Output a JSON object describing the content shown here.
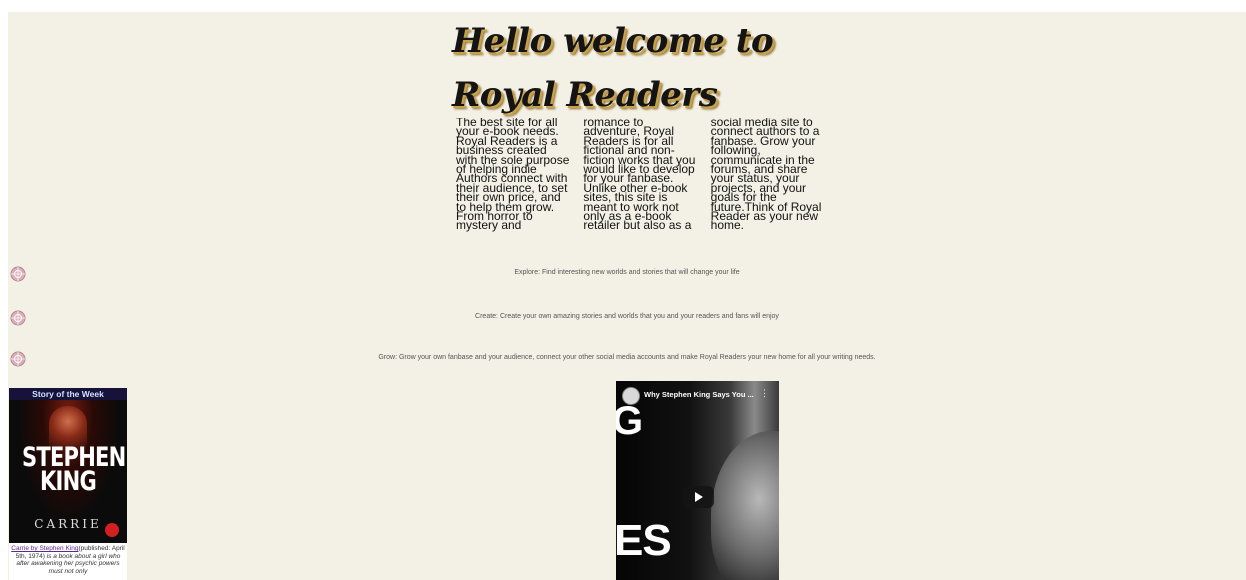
{
  "hero": {
    "title": "Hello welcome to Royal Readers"
  },
  "intro": {
    "text": "The best site for all your e-book needs. Royal Readers is a business created with the sole purpose of helping indie Authors connect with their audience, to set their own price, and to help them grow. From horror to mystery and romance to adventure, Royal Readers is for all fictional and non-fiction works that you would like to develop for your fanbase. Unlike other e-book sites, this site is meant to work not only as a e-book retailer but also as a social media site to connect authors to a fanbase. Grow your following, communicate in the forums, and share your status, your projects, and your goals for the future.Think of Royal Reader as your new home."
  },
  "features": [
    {
      "icon": "ornament-icon",
      "text": "Explore: Find interesting new worlds and stories that will change your life"
    },
    {
      "icon": "ornament-icon",
      "text": "Create: Create your own amazing stories and worlds that you and your readers and fans will enjoy"
    },
    {
      "icon": "ornament-icon",
      "text": "Grow: Grow your own fanbase and your audience, connect your other social media accounts and make Royal Readers your new home for all your writing needs."
    }
  ],
  "story": {
    "header": "Story of the Week",
    "cover_author": "STEPHEN KING",
    "cover_title": "CARRIE",
    "link_text": "Carrie by Stephen King",
    "published": "(published: April 5th, 1974)",
    "description": "is a book about a girl who after awakening her psychic powers must not only"
  },
  "video": {
    "title": "Why Stephen King Says You ...",
    "menu": "⋮",
    "big_letter_top": "G",
    "big_letters_bottom": "ES"
  },
  "colors": {
    "page_background": "#f3f0e6",
    "title_shadow": "#c8a24a",
    "link": "#5a2b8a"
  }
}
